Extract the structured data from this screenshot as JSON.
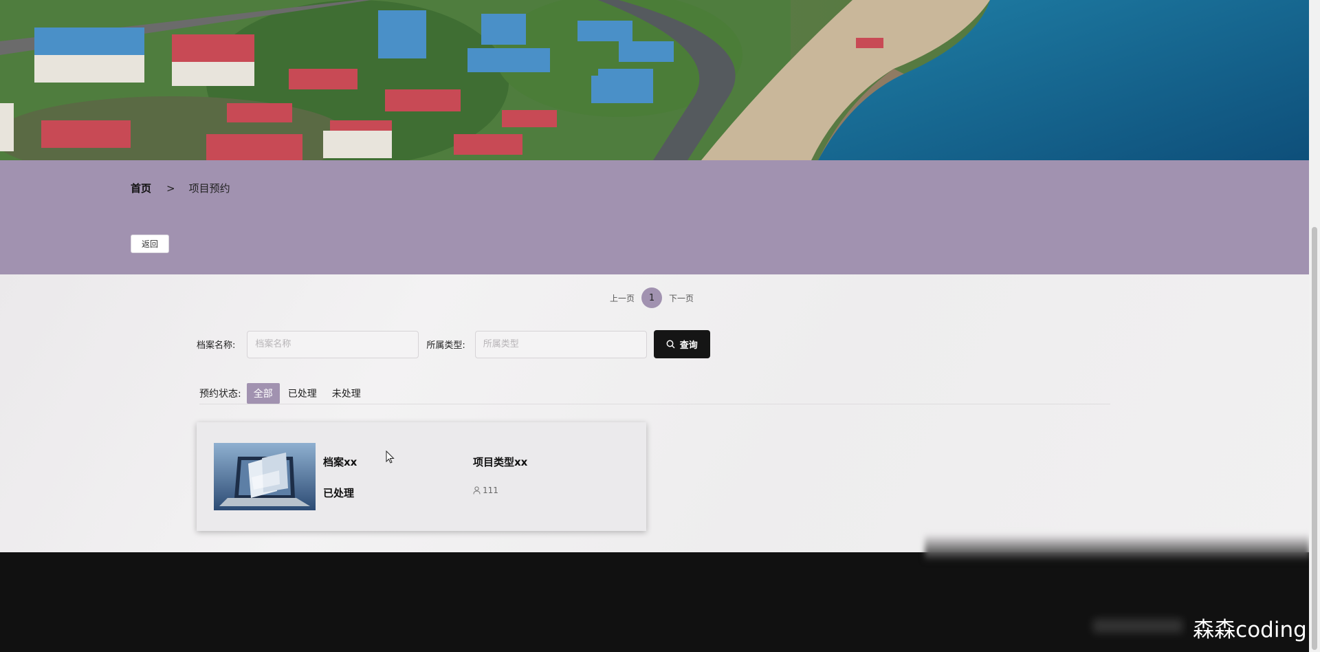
{
  "breadcrumb": {
    "home": "首页",
    "separator": ">",
    "current": "项目预约"
  },
  "back_button": "返回",
  "pagination": {
    "prev": "上一页",
    "current_page": "1",
    "next": "下一页"
  },
  "search": {
    "name_label": "档案名称:",
    "name_placeholder": "档案名称",
    "type_label": "所属类型:",
    "type_placeholder": "所属类型",
    "button_label": "查询",
    "button_icon": "search-icon"
  },
  "status_filter": {
    "label": "预约状态:",
    "options": [
      "全部",
      "已处理",
      "未处理"
    ],
    "active": "全部"
  },
  "cards": [
    {
      "title": "档案xx",
      "type": "项目类型xx",
      "status": "已处理",
      "user_count": "111",
      "image": "laptop-with-documents"
    }
  ],
  "watermark": "森森coding",
  "colors": {
    "accent": "#a192b0",
    "search_button": "#151515",
    "footer": "#111111"
  }
}
